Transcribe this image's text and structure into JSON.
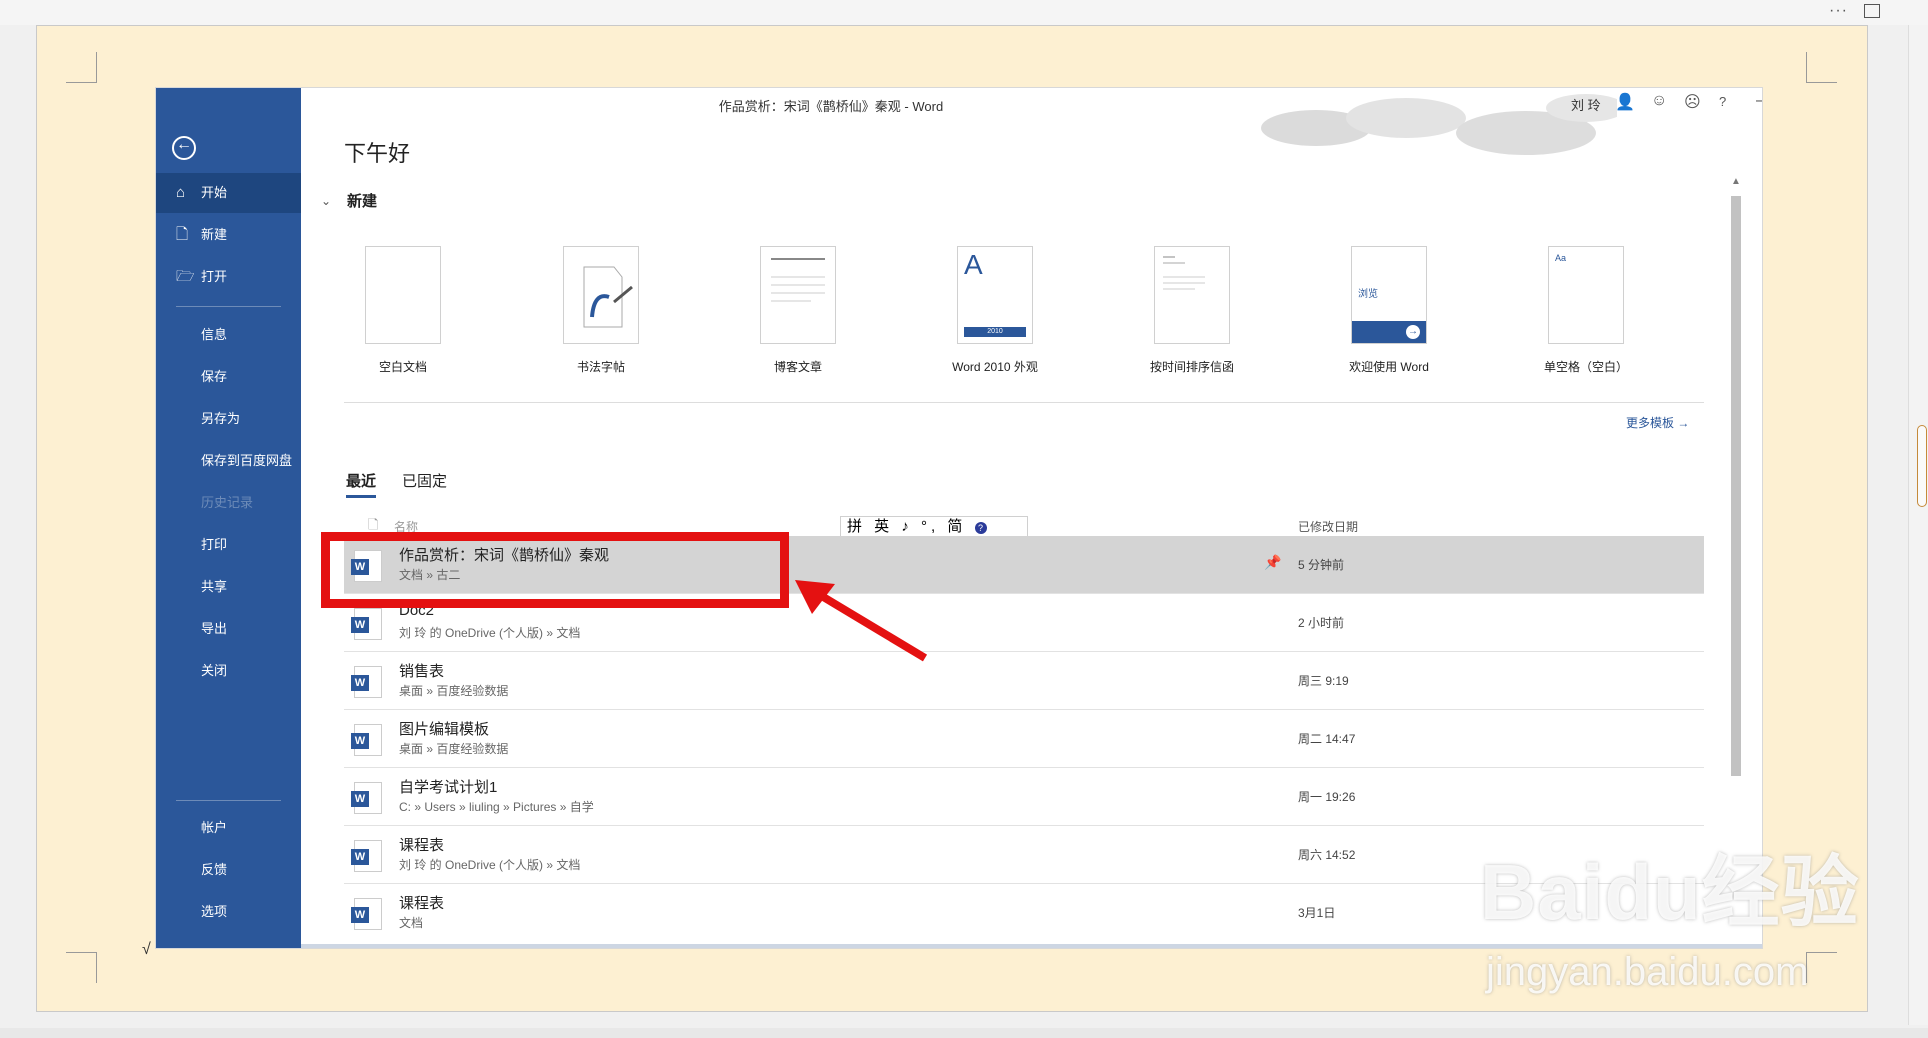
{
  "window": {
    "doc_title": "作品赏析：宋词《鹊桥仙》秦观  -  Word",
    "user_name": "刘 玲"
  },
  "sidebar": {
    "items": [
      {
        "label": "开始",
        "icon": "home-icon"
      },
      {
        "label": "新建",
        "icon": "new-doc-icon"
      },
      {
        "label": "打开",
        "icon": "folder-open-icon"
      },
      {
        "label": "信息"
      },
      {
        "label": "保存"
      },
      {
        "label": "另存为"
      },
      {
        "label": "保存到百度网盘"
      },
      {
        "label": "历史记录"
      },
      {
        "label": "打印"
      },
      {
        "label": "共享"
      },
      {
        "label": "导出"
      },
      {
        "label": "关闭"
      },
      {
        "label": "帐户"
      },
      {
        "label": "反馈"
      },
      {
        "label": "选项"
      }
    ]
  },
  "main": {
    "greeting": "下午好",
    "new_section": "新建",
    "templates": [
      {
        "label": "空白文档"
      },
      {
        "label": "书法字帖"
      },
      {
        "label": "博客文章"
      },
      {
        "label": "Word 2010 外观"
      },
      {
        "label": "按时间排序信函"
      },
      {
        "label": "欢迎使用 Word"
      },
      {
        "label": "单空格（空白）"
      }
    ],
    "template_text": {
      "word2010_year": "2010",
      "welcome_browse": "浏览",
      "single_space_aa": "Aa"
    },
    "more_templates": "更多模板",
    "tabs": [
      "最近",
      "已固定"
    ],
    "col_name": "名称",
    "col_date": "已修改日期",
    "ime_toolbar": "拼 英 ♪ °, 简",
    "files": [
      {
        "name": "作品赏析：宋词《鹊桥仙》秦观",
        "path": "文档 » 古二",
        "date": "5 分钟前"
      },
      {
        "name": "Doc2",
        "path": "刘 玲 的 OneDrive (个人版) » 文档",
        "date": "2 小时前"
      },
      {
        "name": "销售表",
        "path": "桌面 » 百度经验数据",
        "date": "周三 9:19"
      },
      {
        "name": "图片编辑模板",
        "path": "桌面 » 百度经验数据",
        "date": "周二 14:47"
      },
      {
        "name": "自学考试计划1",
        "path": "C: » Users » liuling » Pictures » 自学",
        "date": "周一 19:26"
      },
      {
        "name": "课程表",
        "path": "刘 玲 的 OneDrive (个人版) » 文档",
        "date": "周六 14:52"
      },
      {
        "name": "课程表",
        "path": "文档",
        "date": "3月1日"
      }
    ]
  },
  "watermark": {
    "brand": "Baidu经验",
    "url": "jingyan.baidu.com"
  },
  "colors": {
    "sidebar": "#2b579a",
    "highlight": "#e41111",
    "page": "#fdf0d2"
  }
}
